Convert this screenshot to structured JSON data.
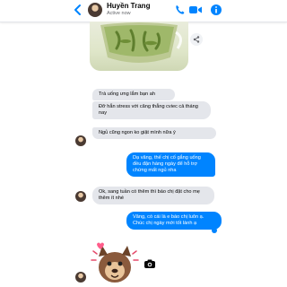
{
  "header": {
    "contact_name": "Huyền Trang",
    "status": "Active now",
    "accent_color": "#0084ff"
  },
  "icons": {
    "back": "back-arrow-icon",
    "phone": "phone-icon",
    "video": "video-camera-icon",
    "info": "info-icon",
    "share": "share-icon",
    "camera": "camera-icon"
  },
  "messages": [
    {
      "side": "in",
      "text": "Trà uống ưng lắm bạn ah"
    },
    {
      "side": "in",
      "text": "Đỡ hẳn stress với căng thẳng cviec cả tháng nay"
    },
    {
      "side": "in",
      "text": "Ngủ cũng ngon ko giật mình nữa ý"
    },
    {
      "side": "out",
      "text": "Dạ vâng, thế chị cố gắng uống đều đặn hàng ngày để hỗ trợ chứng mất ngủ nha"
    },
    {
      "side": "in",
      "text": "Ok, sang tuần có thêm thì báo chị đặt cho mẹ thêm ít nhé"
    },
    {
      "side": "out",
      "text": "Vâng, có cái là e báo chị luôn ạ. Chúc chị ngày mới tốt lành ạ"
    }
  ]
}
